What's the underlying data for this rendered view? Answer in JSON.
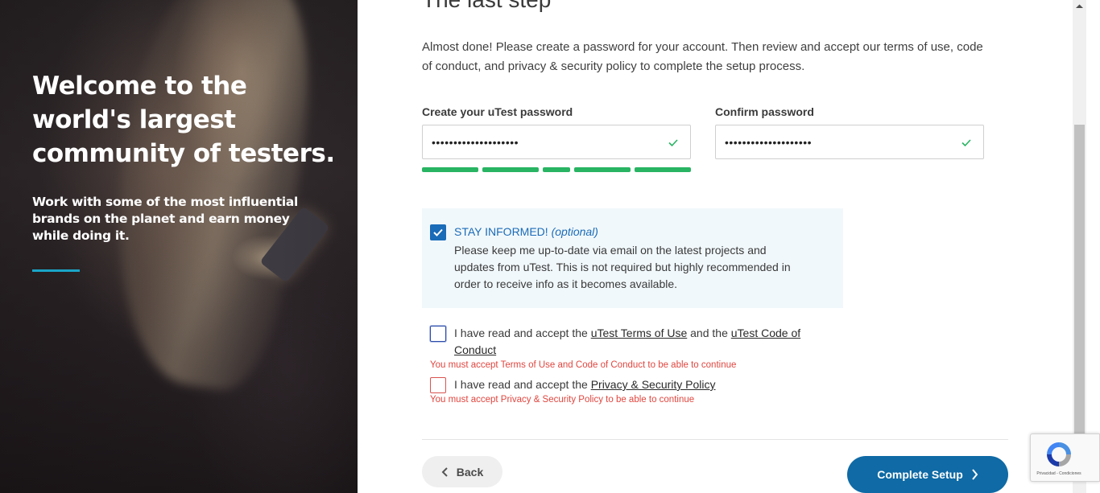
{
  "hero": {
    "title": "Welcome to the world's largest community of testers.",
    "subtitle": "Work with some of the most influential brands on the planet and earn money while doing it.",
    "accent_color": "#1aa5c8"
  },
  "form": {
    "step_title": "The last step",
    "intro": "Almost done! Please create a password for your account. Then review and accept our terms of use, code of conduct, and privacy & security policy to complete the setup process.",
    "password_label": "Create your uTest password",
    "password_value": "••••••••••••••••••••",
    "confirm_label": "Confirm password",
    "confirm_value": "••••••••••••••••••••",
    "strength_color": "#28b463",
    "stay_informed": {
      "title": "STAY INFORMED!",
      "optional": "(optional)",
      "text": "Please keep me up-to-date via email on the latest projects and updates from uTest. This is not required but highly recommended in order to receive info as it becomes available.",
      "checked": true
    },
    "terms": {
      "prefix": "I have read and accept the",
      "terms_link": "uTest Terms of Use",
      "middle": "and the",
      "code_link": "uTest Code of Conduct",
      "error": "You must accept Terms of Use and Code of Conduct to be able to continue",
      "checked": false
    },
    "privacy": {
      "prefix": "I have read and accept the",
      "link": "Privacy & Security Policy",
      "error": "You must accept Privacy & Security Policy to be able to continue",
      "checked": false
    },
    "back_label": "Back",
    "complete_label": "Complete Setup"
  },
  "recaptcha": {
    "links": "Privacidad - Condiciones"
  },
  "colors": {
    "primary": "#0f6aa5",
    "error": "#e0463f",
    "checkbox": "#1a6bb8"
  }
}
